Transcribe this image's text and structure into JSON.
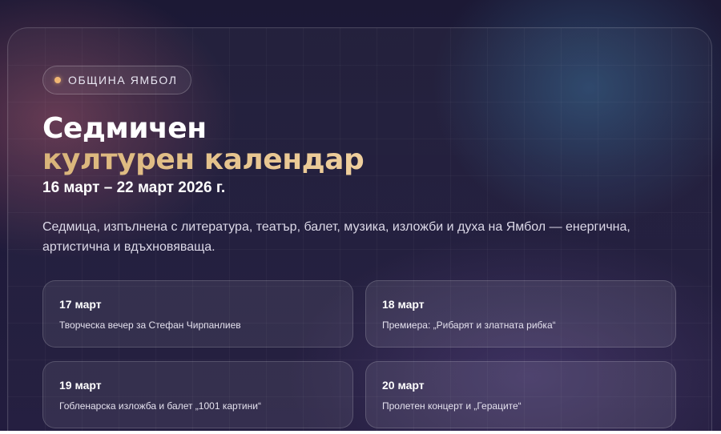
{
  "badge": {
    "label": "ОБЩИНА ЯМБОЛ"
  },
  "heading": {
    "line1": "Седмичен",
    "line2": "културен календар",
    "dates": "16 март – 22 март 2026 г."
  },
  "description": "Седмица, изпълнена с литература, театър, балет, музика, изложби и духа на Ямбол — енергична, артистична и вдъхновяваща.",
  "events": [
    {
      "date": "17 март",
      "title": "Творческа вечер за Стефан Чирпанлиев"
    },
    {
      "date": "18 март",
      "title": "Премиера: „Рибарят и златната рибка“"
    },
    {
      "date": "19 март",
      "title": "Гобленарска изложба и балет „1001 картини“"
    },
    {
      "date": "20 март",
      "title": "Пролетен концерт и „Гераците“"
    }
  ],
  "colors": {
    "accent_gold": "#e3bd87",
    "badge_dot": "#f0b673",
    "background": "#1f1b3b"
  }
}
